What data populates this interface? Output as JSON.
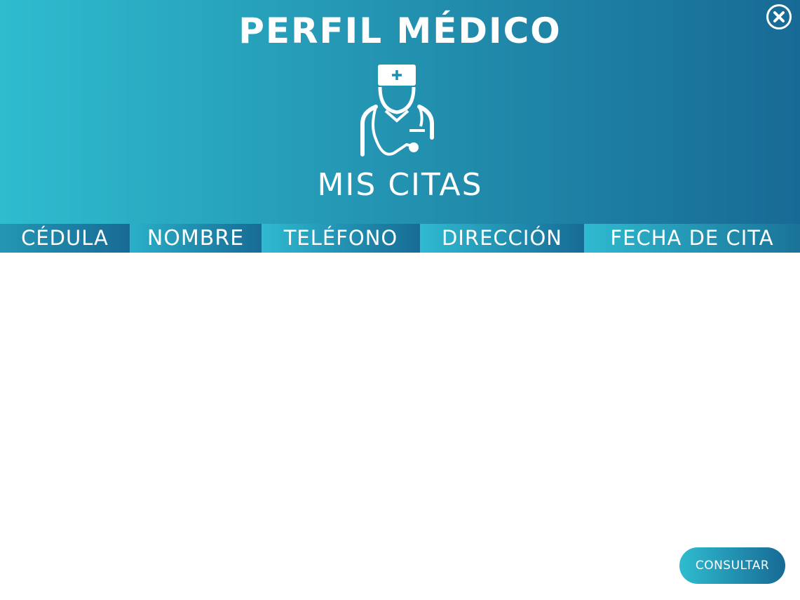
{
  "header": {
    "title": "PERFIL MÉDICO",
    "subtitle": "MIS CITAS",
    "icon": "doctor-stethoscope-icon",
    "close_icon": "close-circle-icon"
  },
  "table": {
    "columns": [
      "CÉDULA",
      "NOMBRE",
      "TELÉFONO",
      "DIRECCIÓN",
      "FECHA DE CITA"
    ]
  },
  "actions": {
    "consult_label": "CONSULTAR"
  },
  "colors": {
    "gradient_start": "#2fbccf",
    "gradient_end": "#176a95",
    "text": "#ffffff"
  }
}
